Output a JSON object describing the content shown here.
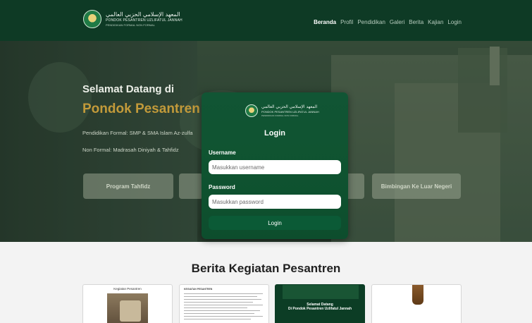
{
  "navbar": {
    "brand_arabic": "المعهد الإسلامي الحزبي العالمي",
    "brand_name": "PONDOK PESANTREN UZLIFATUL JANNAH",
    "brand_sub": "PENDIDIKAN FORMAL NON FORMAL",
    "menu": [
      "Beranda",
      "Profil",
      "Pendidikan",
      "Galeri",
      "Berita",
      "Kajian",
      "Login"
    ],
    "active_index": 0
  },
  "hero": {
    "welcome": "Selamat Datang di",
    "school": "Pondok Pesantren Uzlifatul Jannah",
    "formal": "Pendidikan Formal: SMP & SMA Islam Az-zulfa",
    "nonformal": "Non Formal: Madrasah Diniyah & Tahfidz",
    "programs": [
      "Program Tahfidz",
      "",
      "",
      "Bimbingan Ke Luar Negeri"
    ]
  },
  "login_modal": {
    "brand_arabic": "المعهد الإسلامي الحزبي العالمي",
    "brand_name": "PONDOK PESANTREN UZLIFATUL JANNAH",
    "brand_sub": "PENDIDIKAN FORMAL NON FORMAL",
    "title": "Login",
    "username_label": "Username",
    "username_placeholder": "Masukkan username",
    "password_label": "Password",
    "password_placeholder": "Masukkan password",
    "submit_label": "Login"
  },
  "news": {
    "title": "Berita Kegiatan Pesantren",
    "cards": [
      {
        "caption": "Kegiatan Pesantren"
      },
      {
        "heading": "KEGIATAN PESANTREN"
      },
      {
        "welcome": "Selamat Datang",
        "school": "Di Pondok Pesantren Uzlifatul Jannah"
      },
      {}
    ]
  },
  "colors": {
    "navbar": "#0e3a25",
    "modal": "#115534",
    "accent_gold": "#c29a3a",
    "news_bg": "#f3f3f3"
  }
}
